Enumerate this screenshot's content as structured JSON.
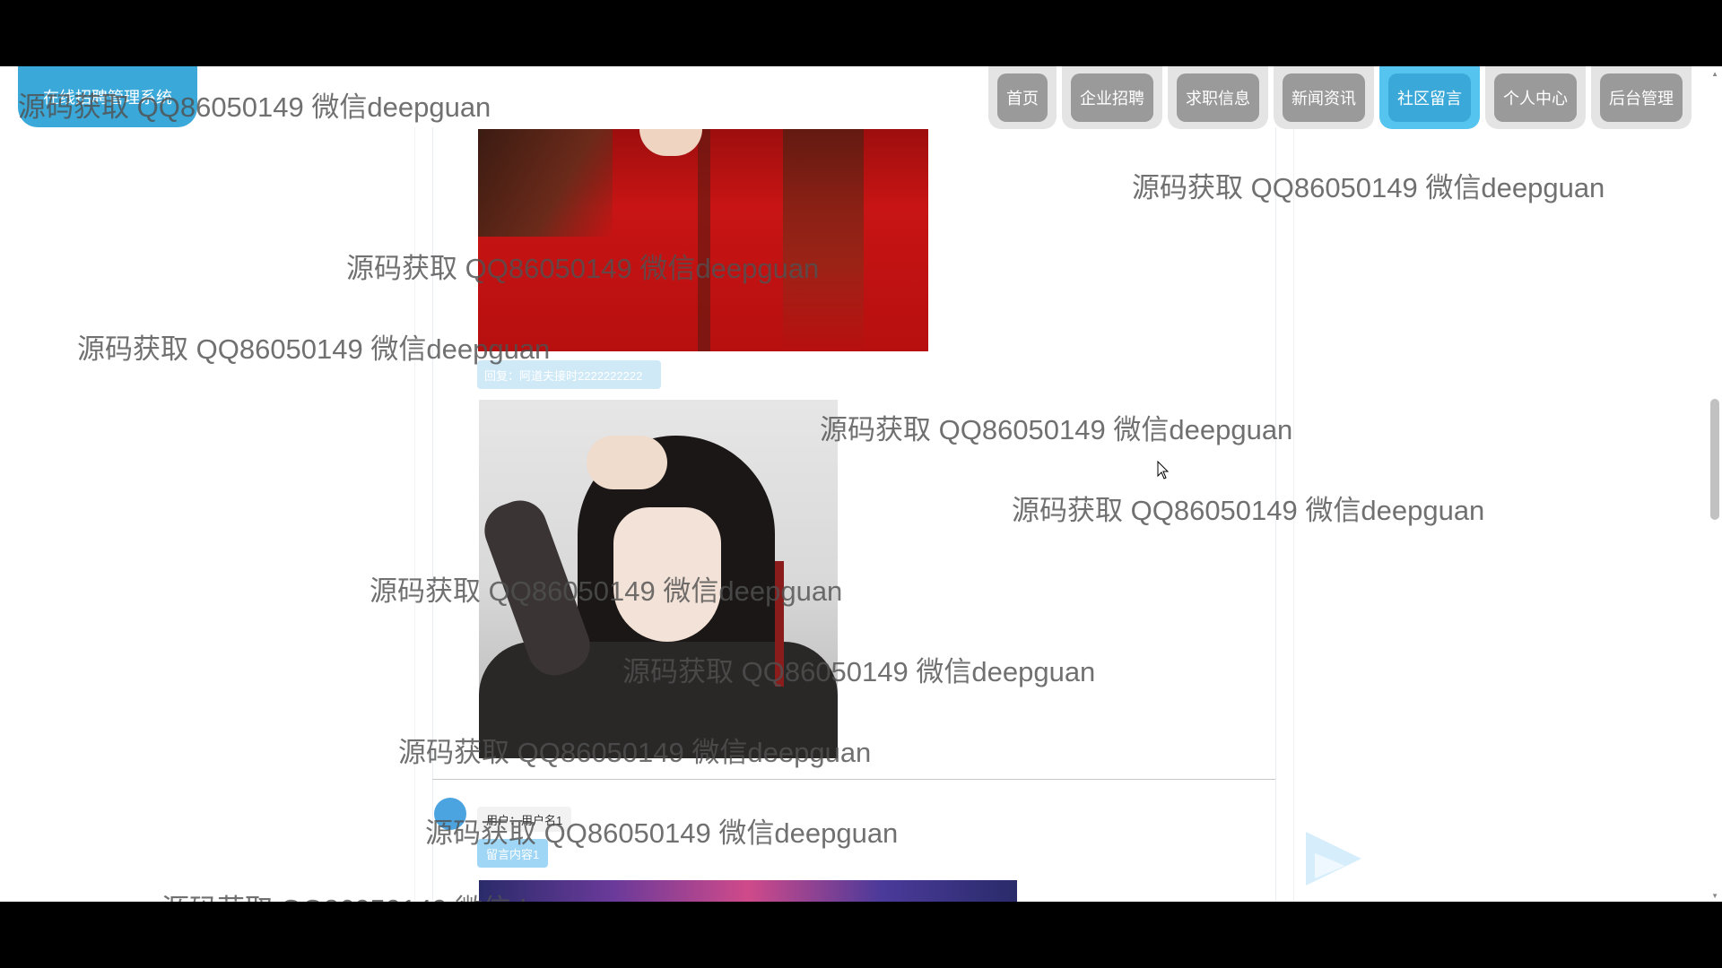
{
  "header": {
    "logo_text": "在线招聘管理系统",
    "nav": [
      {
        "label": "首页",
        "active": false
      },
      {
        "label": "企业招聘",
        "active": false
      },
      {
        "label": "求职信息",
        "active": false
      },
      {
        "label": "新闻资讯",
        "active": false
      },
      {
        "label": "社区留言",
        "active": true
      },
      {
        "label": "个人中心",
        "active": false
      },
      {
        "label": "后台管理",
        "active": false
      }
    ]
  },
  "content": {
    "reply_text": "回复：阿道夫接时2222222222",
    "comment_user": "用户：用户名1",
    "comment_text": "留言内容1"
  },
  "watermark": "源码获取 QQ86050149 微信deepguan",
  "colors": {
    "accent": "#3aa8d8",
    "nav_inactive": "#9a9a9a"
  }
}
